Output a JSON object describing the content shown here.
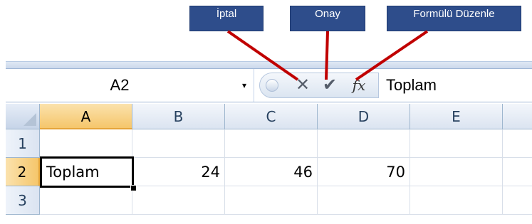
{
  "callouts": {
    "cancel": "İptal",
    "ok": "Onay",
    "insert_function": "Formülü Düzenle"
  },
  "name_box": {
    "value": "A2",
    "dropdown_icon": "▾"
  },
  "formula_bar": {
    "cancel_icon": "✕",
    "enter_icon": "✔",
    "fx_icon": "fx",
    "value": "Toplam"
  },
  "grid": {
    "columns": [
      "A",
      "B",
      "C",
      "D",
      "E"
    ],
    "rows": [
      "1",
      "2",
      "3"
    ],
    "cells": {
      "A2": "Toplam",
      "B2": "24",
      "C2": "46",
      "D2": "70"
    },
    "active_cell": "A2"
  },
  "colors": {
    "callout_bg": "#2e4d8b",
    "arrow": "#c00000",
    "active_header": "#f5c66b"
  }
}
